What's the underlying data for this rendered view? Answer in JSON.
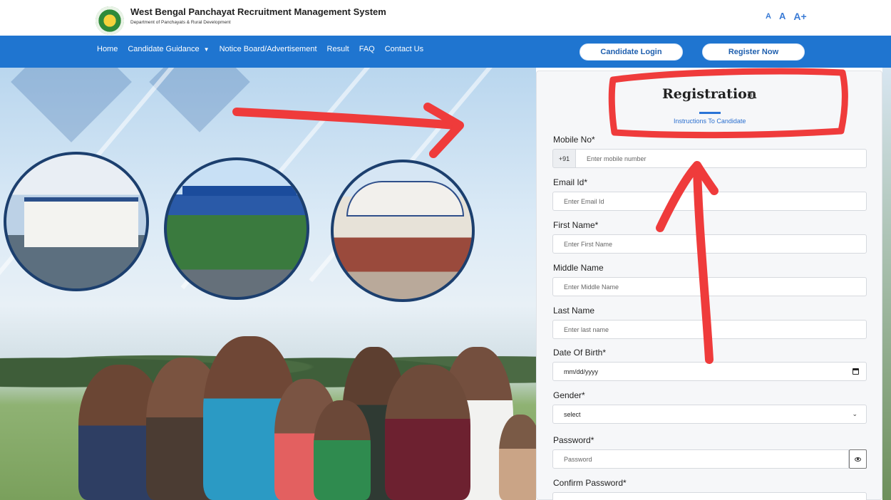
{
  "header": {
    "title": "West Bengal Panchayat Recruitment Management System",
    "subtitle": "Department of Panchayats & Rural Development",
    "font_controls": [
      "A",
      "A",
      "A+"
    ]
  },
  "nav": {
    "items": [
      {
        "label": "Home"
      },
      {
        "label": "Candidate Guidance"
      },
      {
        "label": "Notice Board/Advertisement"
      },
      {
        "label": "Result"
      },
      {
        "label": "FAQ"
      },
      {
        "label": "Contact Us"
      }
    ],
    "candidate_login": "Candidate Login",
    "register_now": "Register Now"
  },
  "registration": {
    "title": "Registration",
    "instructions_link": "Instructions To Candidate",
    "fields": {
      "mobile": {
        "label": "Mobile No*",
        "prefix": "+91",
        "placeholder": "Enter mobile number"
      },
      "email": {
        "label": "Email Id*",
        "placeholder": "Enter Email Id"
      },
      "first_name": {
        "label": "First Name*",
        "placeholder": "Enter First Name"
      },
      "middle_name": {
        "label": "Middle Name",
        "placeholder": "Enter Middle Name"
      },
      "last_name": {
        "label": "Last Name",
        "placeholder": "Enter last name"
      },
      "dob": {
        "label": "Date Of Birth*",
        "value": "mm/dd/yyyy"
      },
      "gender": {
        "label": "Gender*",
        "value": "select"
      },
      "password": {
        "label": "Password*",
        "placeholder": "Password"
      },
      "confirm_password": {
        "label": "Confirm Password*"
      }
    }
  },
  "colors": {
    "nav_bg": "#1f75d0",
    "annotation_red": "#ef3b3b",
    "link_blue": "#2a6fcf"
  },
  "icons": [
    "emblem-logo",
    "info-icon",
    "calendar-icon",
    "chevron-down-icon",
    "eye-icon",
    "caret-down-icon"
  ]
}
